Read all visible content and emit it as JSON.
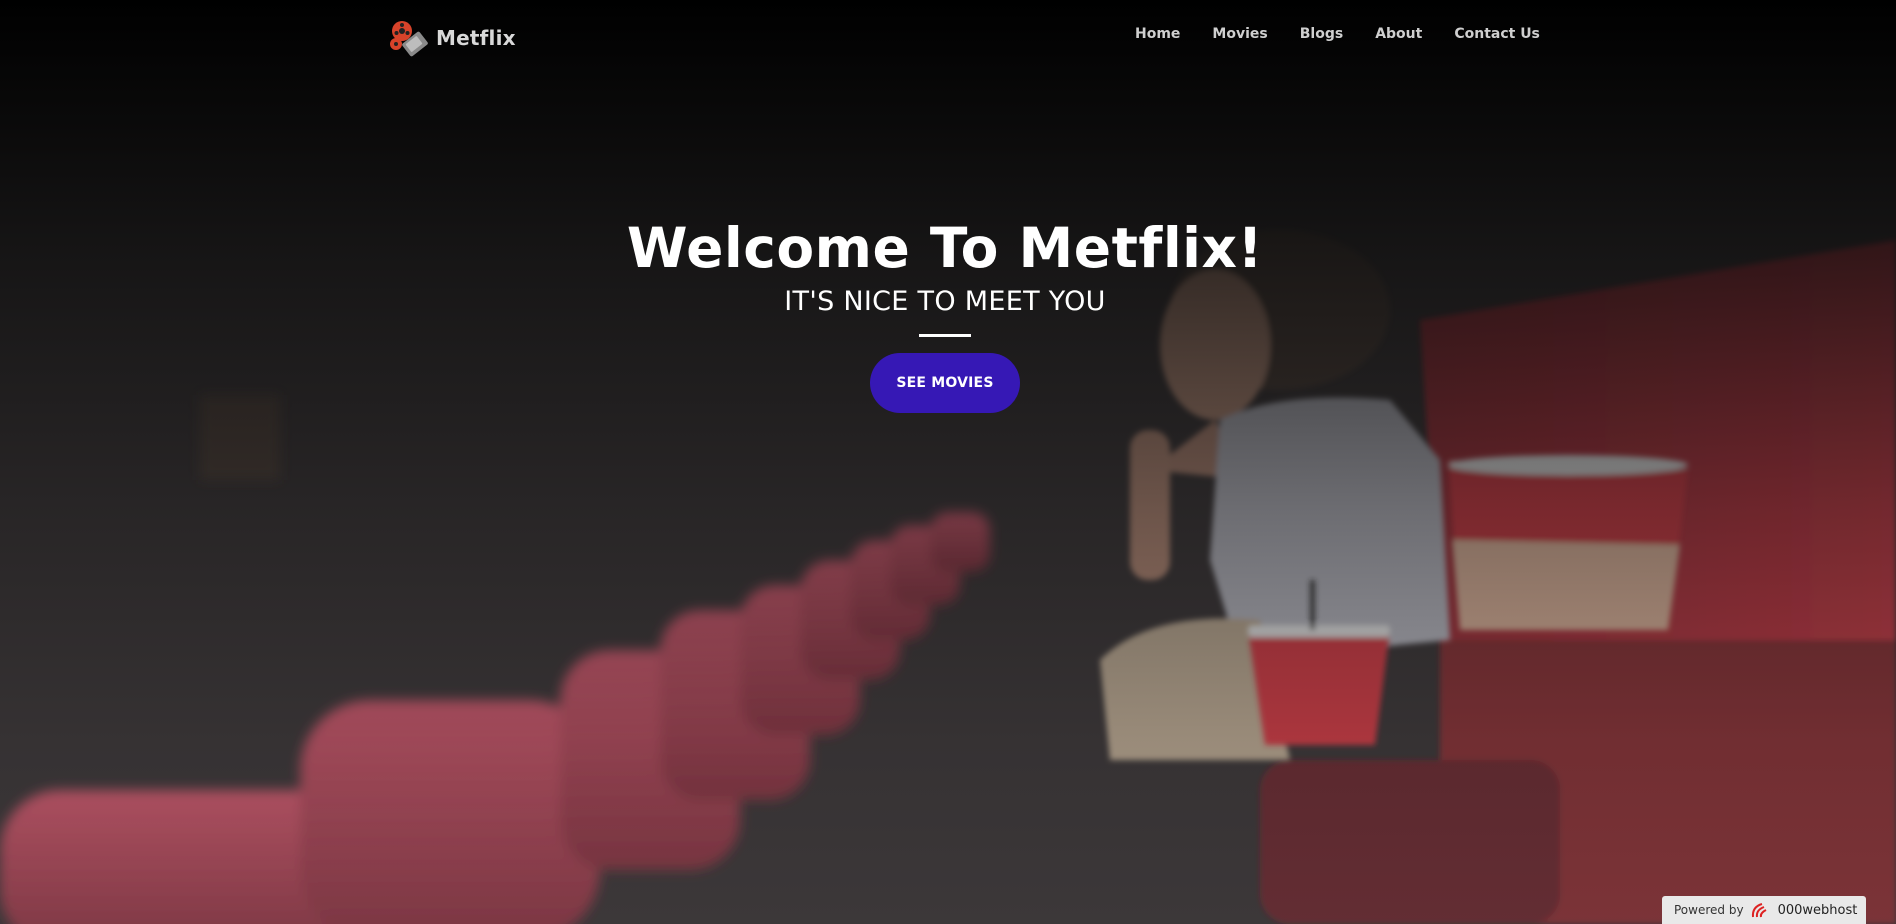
{
  "brand": {
    "name": "Metflix",
    "logo_icon": "film-reel-icon"
  },
  "nav": {
    "items": [
      {
        "label": "Home"
      },
      {
        "label": "Movies"
      },
      {
        "label": "Blogs"
      },
      {
        "label": "About"
      },
      {
        "label": "Contact Us"
      }
    ]
  },
  "hero": {
    "title": "Welcome To Metflix!",
    "subtitle": "IT'S NICE TO MEET YOU",
    "button_label": "SEE MOVIES",
    "background": "cinema-audience-photo"
  },
  "footer_badge": {
    "prefix": "Powered by",
    "brand": "000webhost",
    "icon": "000webhost-logo-icon"
  },
  "colors": {
    "accent": "#3618b5",
    "seat_red": "#b8243a",
    "popcorn_red": "#d5222d"
  }
}
